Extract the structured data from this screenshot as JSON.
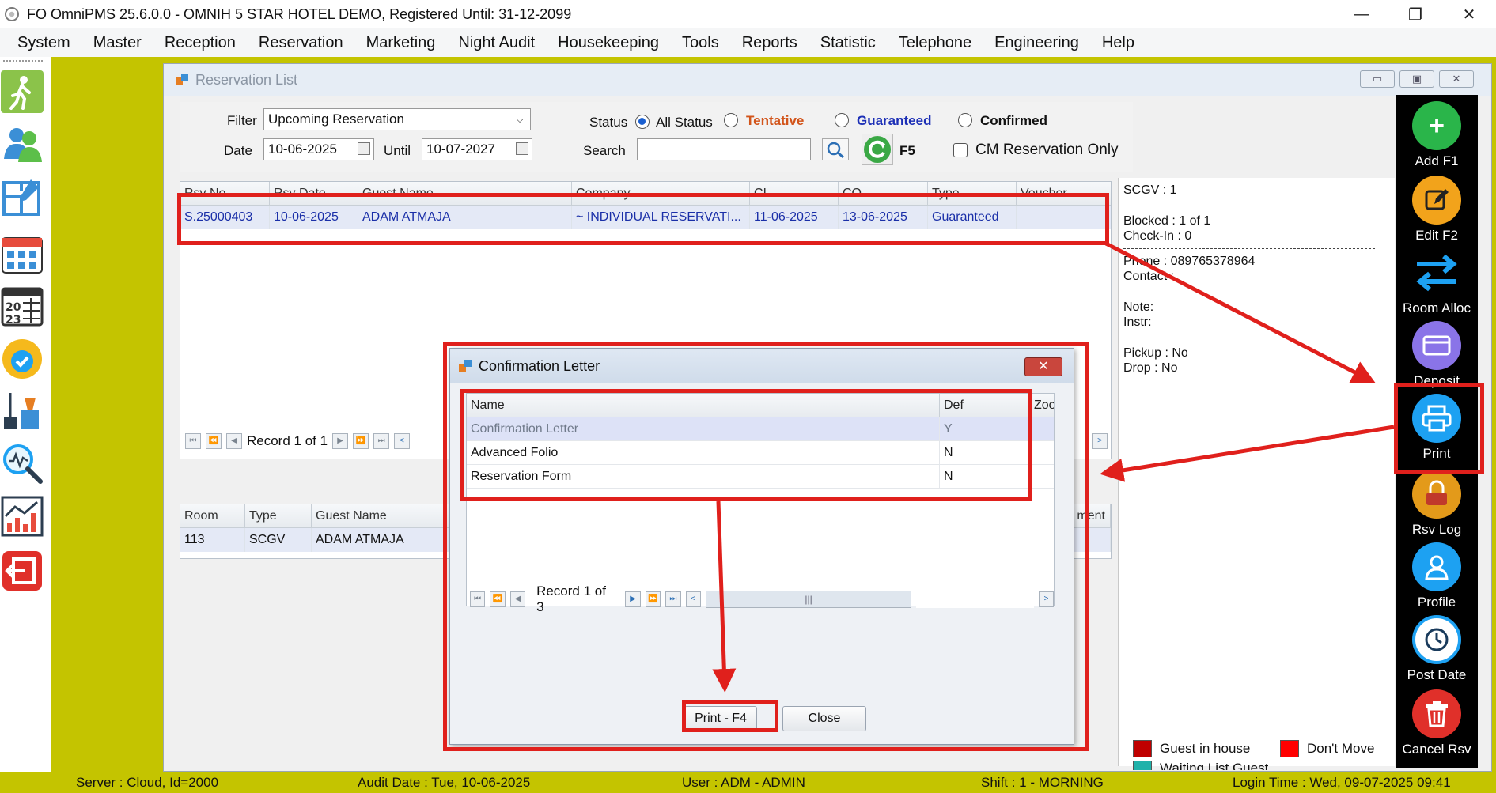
{
  "window": {
    "title": "FO OmniPMS 25.6.0.0 - OMNIH 5 STAR HOTEL DEMO, Registered Until: 31-12-2099",
    "controls": [
      "—",
      "❐",
      "✕"
    ]
  },
  "menu": [
    "System",
    "Master",
    "Reception",
    "Reservation",
    "Marketing",
    "Night Audit",
    "Housekeeping",
    "Tools",
    "Reports",
    "Statistic",
    "Telephone",
    "Engineering",
    "Help"
  ],
  "sidebar_icons": [
    "walk-in-icon",
    "guests-icon",
    "floor-plan-icon",
    "calendar-grid-icon",
    "calendar-2023-icon",
    "available-badge-icon",
    "housekeeping-icon",
    "search-analysis-icon",
    "report-chart-icon",
    "exit-icon"
  ],
  "reservation_list": {
    "title": "Reservation List",
    "filter_label": "Filter",
    "filter_value": "Upcoming Reservation",
    "date_label": "Date",
    "date_from": "10-06-2025",
    "until_label": "Until",
    "date_until": "10-07-2027",
    "status_label": "Status",
    "status_options": [
      {
        "label": "All Status",
        "selected": true,
        "color": "#111111"
      },
      {
        "label": "Tentative",
        "selected": false,
        "color": "#d2541a"
      },
      {
        "label": "Guaranteed",
        "selected": false,
        "color": "#1c2fb6"
      },
      {
        "label": "Confirmed",
        "selected": false,
        "color": "#111111"
      }
    ],
    "search_label": "Search",
    "search_value": "",
    "refresh_label": "F5",
    "cm_only_label": "CM Reservation Only",
    "columns": [
      "Rsv No",
      "Rsv Date",
      "Guest Name",
      "Company",
      "CI",
      "CO",
      "Type",
      "Voucher"
    ],
    "rows": [
      [
        "S.25000403",
        "10-06-2025",
        "ADAM ATMAJA",
        "~ INDIVIDUAL RESERVATI...",
        "11-06-2025",
        "13-06-2025",
        "Guaranteed",
        ""
      ]
    ],
    "record_text": "Record 1 of 1",
    "room_columns": [
      "Room",
      "Type",
      "Guest Name",
      "ment"
    ],
    "room_rows": [
      [
        "113",
        "SCGV",
        "ADAM ATMAJA"
      ]
    ]
  },
  "info_panel": {
    "room_type": "SCGV : 1",
    "blocked": "Blocked : 1 of 1",
    "checkin": "Check-In : 0",
    "phone": "Phone : 089765378964",
    "contact": "Contact :",
    "note": "Note:",
    "instr": "Instr:",
    "pickup": "Pickup : No",
    "drop": "Drop : No"
  },
  "legend": [
    {
      "label": "Guest in house",
      "color": "#c00000"
    },
    {
      "label": "Don't Move",
      "color": "#ff0000"
    },
    {
      "label": "Waiting List Guest",
      "color": "#20b2aa"
    }
  ],
  "toolbar": [
    {
      "label": "Add F1",
      "icon": "plus-icon",
      "color": "#2ab54a"
    },
    {
      "label": "Edit F2",
      "icon": "edit-icon",
      "color": "#f2a31b"
    },
    {
      "label": "Room Alloc",
      "icon": "swap-arrows-icon",
      "color": "#1e8fe0"
    },
    {
      "label": "Deposit",
      "icon": "deposit-card-icon",
      "color": "#8a74e8"
    },
    {
      "label": "Print",
      "icon": "printer-icon",
      "color": "#1da1f2"
    },
    {
      "label": "Rsv Log",
      "icon": "lock-log-icon",
      "color": "#e39a1a"
    },
    {
      "label": "Profile",
      "icon": "profile-icon",
      "color": "#1da1f2"
    },
    {
      "label": "Post Date",
      "icon": "clock-icon",
      "color": "#1da1f2"
    },
    {
      "label": "Cancel Rsv",
      "icon": "trash-icon",
      "color": "#e0302a"
    }
  ],
  "dialog": {
    "title": "Confirmation Letter",
    "columns": [
      "Name",
      "Def",
      "Zoo"
    ],
    "rows": [
      [
        "Confirmation Letter",
        "Y"
      ],
      [
        "Advanced Folio",
        "N"
      ],
      [
        "Reservation Form",
        "N"
      ]
    ],
    "record_text": "Record 1 of 3",
    "print_button": "Print - F4",
    "close_button": "Close"
  },
  "status_bar": {
    "server": "Server : Cloud, Id=2000",
    "audit_date": "Audit Date : Tue, 10-06-2025",
    "user": "User : ADM - ADMIN",
    "shift": "Shift : 1 - MORNING",
    "login_time": "Login Time : Wed, 09-07-2025 09:41"
  },
  "colors": {
    "accent_olive": "#c4c400",
    "annotation_red": "#e0201c",
    "row_text_blue": "#1a2fa8"
  }
}
